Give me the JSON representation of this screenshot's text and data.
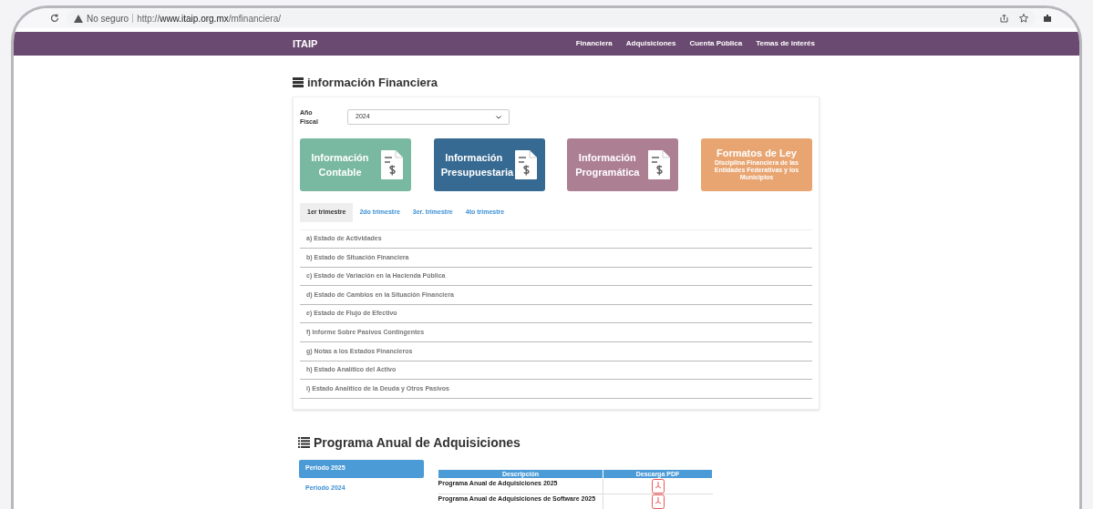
{
  "browser": {
    "security": "No seguro",
    "url_prefix": "http://",
    "url_host": "www.itaip.org.mx",
    "url_path": "/mfinanciera/"
  },
  "navbar": {
    "brand": "ITAIP",
    "links": [
      "Financiera",
      "Adquisiciones",
      "Cuenta Pública",
      "Temas de interés"
    ]
  },
  "financiera": {
    "title": "información Financiera",
    "year_label": "Año Fiscal",
    "year_value": "2024",
    "tiles": [
      {
        "title": "Información Contable",
        "color": "#7ab9a1"
      },
      {
        "title": "Información Presupuestaria",
        "color": "#376a92"
      },
      {
        "title": "Información Programática",
        "color": "#ad7f93"
      },
      {
        "title": "Formatos de Ley",
        "subtitle": "Disciplina Financiera de las Entidades Federativas y los Municipios",
        "color": "#e8a571"
      }
    ],
    "tabs": [
      {
        "label": "1er trimestre",
        "selected": true
      },
      {
        "label": "2do trimestre",
        "selected": false
      },
      {
        "label": "3er. trimestre",
        "selected": false
      },
      {
        "label": "4to trimestre",
        "selected": false
      }
    ],
    "rows": [
      "a) Estado de Actividades",
      "b) Estado de Situación Financiera",
      "c) Estado de Variación en la Hacienda Pública",
      "d) Estado de Cambios en la Situación Financiera",
      "e) Estado de Flujo de Efectivo",
      "f) Informe Sobre Pasivos Contingentes",
      "g) Notas a los Estados Financieros",
      "h) Estado Analítico del Activo",
      "i) Estado Analítico de la Deuda y Otros Pasivos"
    ]
  },
  "adquisiciones": {
    "title": "Programa Anual de Adquisiciones",
    "periods": [
      {
        "label": "Periodo 2025",
        "selected": true
      },
      {
        "label": "Periodo 2024",
        "selected": false
      }
    ],
    "table": {
      "columns": [
        "Descripción",
        "Descarga PDF"
      ],
      "rows": [
        {
          "description": "Programa Anual de Adquisiciones 2025"
        },
        {
          "description": "Programa Anual de Adquisiciones de Software 2025"
        }
      ]
    }
  }
}
